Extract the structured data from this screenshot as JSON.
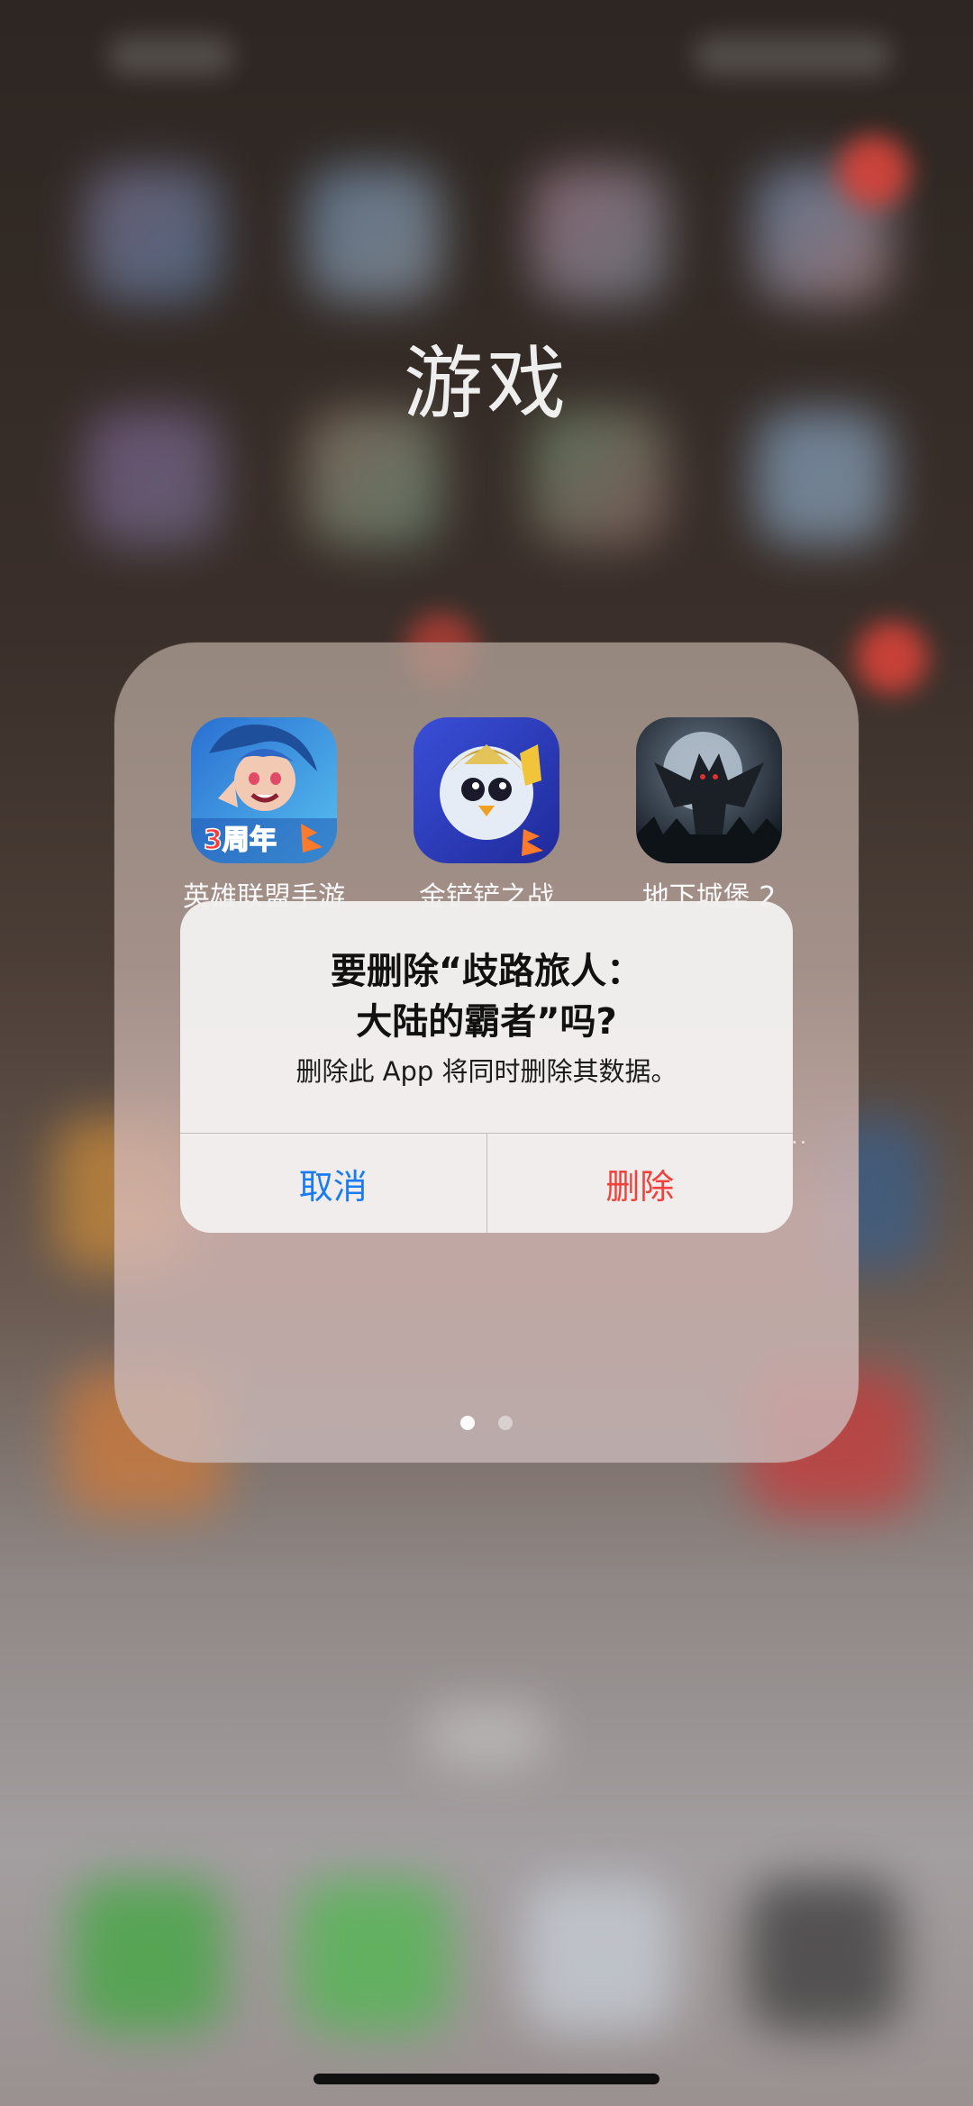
{
  "folder": {
    "title": "游戏",
    "apps": [
      {
        "label": "英雄联盟手游",
        "icon": "league-of-legends-wild-rift-icon",
        "badge_text": "3周年"
      },
      {
        "label": "金铲铲之战",
        "icon": "golden-spatula-icon"
      },
      {
        "label": "地下城堡 2",
        "icon": "dungeon-castle-2-icon"
      }
    ],
    "page_count": 2,
    "current_page": 1
  },
  "alert": {
    "title_line1": "要删除“歧路旅人：",
    "title_line2": "大陆的霸者”吗?",
    "message": "删除此 App 将同时删除其数据。",
    "cancel_label": "取消",
    "delete_label": "删除"
  },
  "colors": {
    "cancel": "#1a7cf0",
    "delete": "#f0413a"
  }
}
